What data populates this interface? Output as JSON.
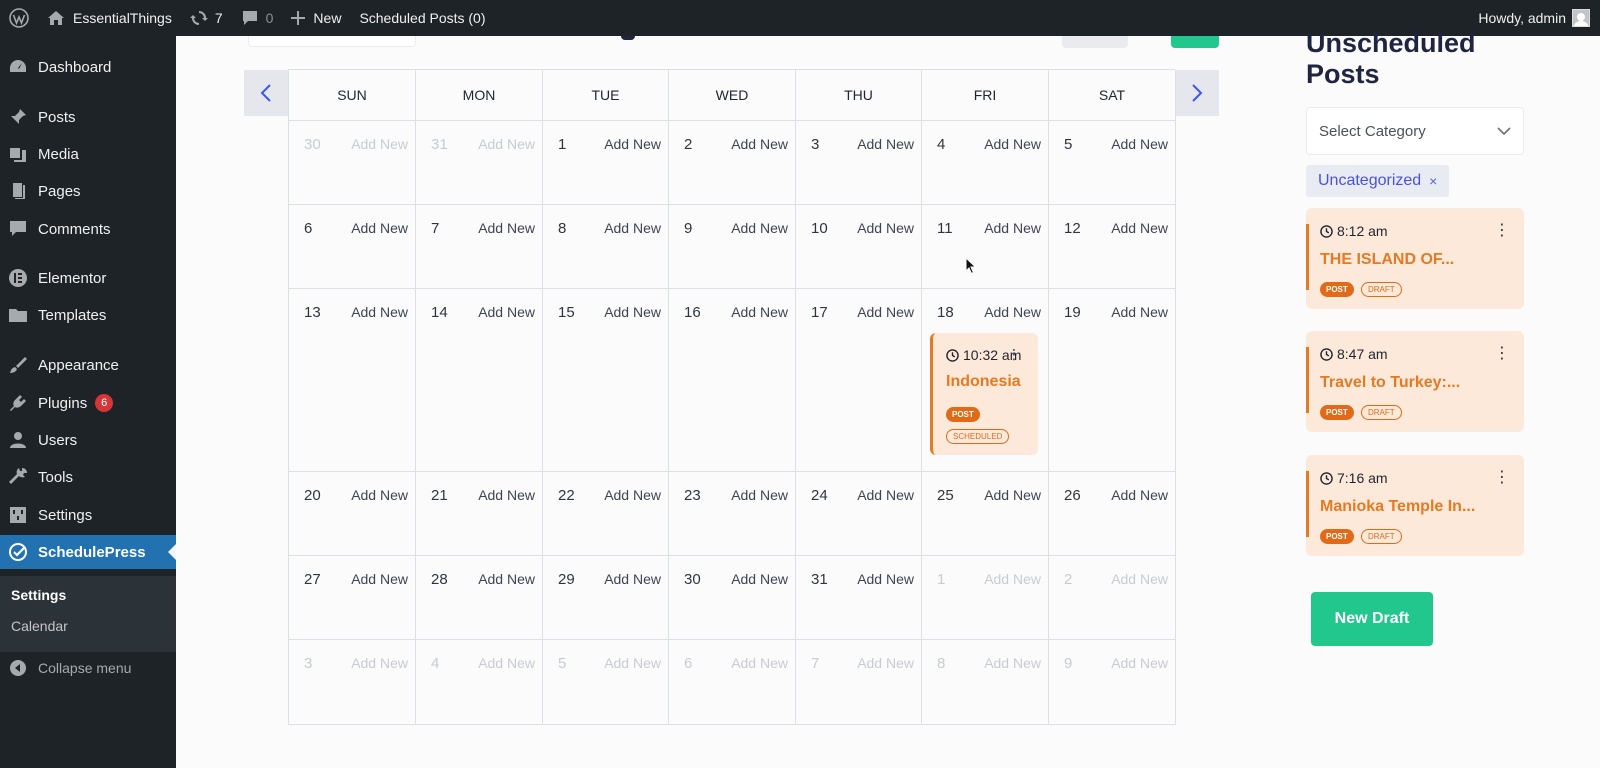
{
  "adminbar": {
    "site_name": "EssentialThings",
    "updates_count": "7",
    "comments_count": "0",
    "new_label": "New",
    "scheduled_label": "Scheduled Posts (0)",
    "howdy": "Howdy, admin"
  },
  "sidebar": {
    "items": [
      {
        "label": "Dashboard",
        "icon": "dashboard-icon"
      },
      {
        "label": "Posts",
        "icon": "pin-icon"
      },
      {
        "label": "Media",
        "icon": "media-icon"
      },
      {
        "label": "Pages",
        "icon": "pages-icon"
      },
      {
        "label": "Comments",
        "icon": "comment-icon"
      },
      {
        "label": "Elementor",
        "icon": "elementor-icon"
      },
      {
        "label": "Templates",
        "icon": "folder-icon"
      },
      {
        "label": "Appearance",
        "icon": "brush-icon"
      },
      {
        "label": "Plugins",
        "icon": "plugin-icon",
        "badge": "6"
      },
      {
        "label": "Users",
        "icon": "user-icon"
      },
      {
        "label": "Tools",
        "icon": "wrench-icon"
      },
      {
        "label": "Settings",
        "icon": "settings-icon"
      },
      {
        "label": "SchedulePress",
        "icon": "schedulepress-icon"
      }
    ],
    "submenu": [
      "Settings",
      "Calendar"
    ],
    "collapse_label": "Collapse menu"
  },
  "calendar": {
    "days": [
      "SUN",
      "MON",
      "TUE",
      "WED",
      "THU",
      "FRI",
      "SAT"
    ],
    "add_label": "Add New",
    "weeks": [
      [
        {
          "d": "30",
          "m": true
        },
        {
          "d": "31",
          "m": true
        },
        {
          "d": "1"
        },
        {
          "d": "2"
        },
        {
          "d": "3"
        },
        {
          "d": "4"
        },
        {
          "d": "5"
        }
      ],
      [
        {
          "d": "6"
        },
        {
          "d": "7"
        },
        {
          "d": "8"
        },
        {
          "d": "9"
        },
        {
          "d": "10"
        },
        {
          "d": "11"
        },
        {
          "d": "12"
        }
      ],
      [
        {
          "d": "13"
        },
        {
          "d": "14"
        },
        {
          "d": "15"
        },
        {
          "d": "16"
        },
        {
          "d": "17"
        },
        {
          "d": "18"
        },
        {
          "d": "19"
        }
      ],
      [
        {
          "d": "20"
        },
        {
          "d": "21"
        },
        {
          "d": "22"
        },
        {
          "d": "23"
        },
        {
          "d": "24"
        },
        {
          "d": "25"
        },
        {
          "d": "26"
        }
      ],
      [
        {
          "d": "27"
        },
        {
          "d": "28"
        },
        {
          "d": "29"
        },
        {
          "d": "30"
        },
        {
          "d": "31"
        },
        {
          "d": "1",
          "m": true
        },
        {
          "d": "2",
          "m": true
        }
      ],
      [
        {
          "d": "3",
          "m": true
        },
        {
          "d": "4",
          "m": true
        },
        {
          "d": "5",
          "m": true
        },
        {
          "d": "6",
          "m": true
        },
        {
          "d": "7",
          "m": true
        },
        {
          "d": "8",
          "m": true
        },
        {
          "d": "9",
          "m": true
        }
      ]
    ],
    "event": {
      "time": "10:32 am",
      "title": "Indonesia",
      "type": "POST",
      "status": "SCHEDULED"
    }
  },
  "panel": {
    "title_line1": "Unscheduled",
    "title_line2": "Posts",
    "select_placeholder": "Select Category",
    "chip_label": "Uncategorized",
    "chip_remove": "×",
    "cards": [
      {
        "time": "8:12 am",
        "title": "THE ISLAND OF...",
        "type": "POST",
        "status": "DRAFT"
      },
      {
        "time": "8:47 am",
        "title": "Travel to Turkey:...",
        "type": "POST",
        "status": "DRAFT"
      },
      {
        "time": "7:16 am",
        "title": "Manioka Temple In...",
        "type": "POST",
        "status": "DRAFT"
      }
    ],
    "new_draft_label": "New Draft"
  },
  "colors": {
    "accent_orange": "#e37a24",
    "card_bg": "#fde9da",
    "green": "#21c78c",
    "wp_blue": "#2271b1",
    "admin_dark": "#1d2327"
  }
}
